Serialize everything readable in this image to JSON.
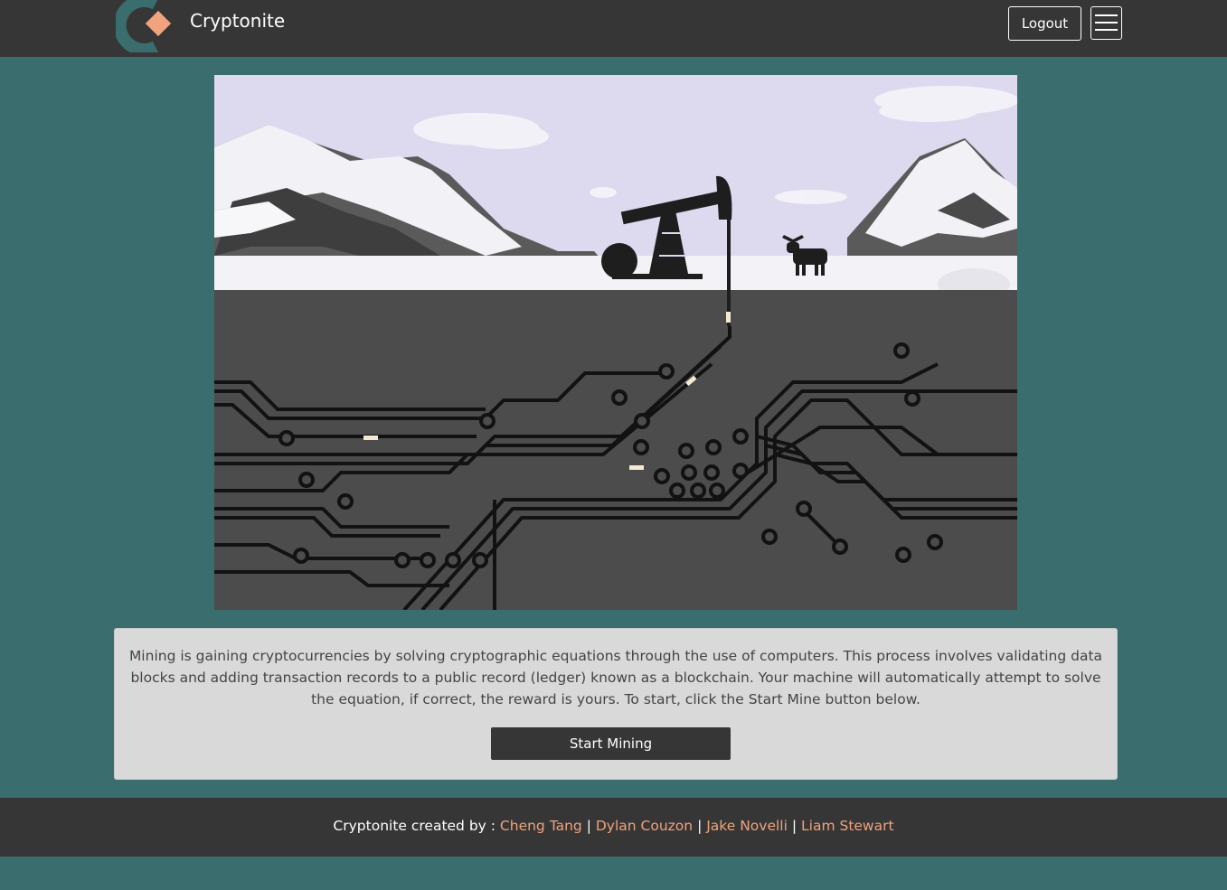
{
  "app": {
    "brand": "Cryptonite",
    "colors": {
      "navbar": "#363636",
      "background": "#3a6e6e",
      "accent": "#f0a37d",
      "logo_c": "#3a6e6e"
    }
  },
  "header": {
    "logout_label": "Logout",
    "menu_icon": "hamburger-icon"
  },
  "hero": {
    "image_description_icon": "oil-pumpjack-circuit-illustration"
  },
  "info": {
    "text": "Mining is gaining cryptocurrencies by solving cryptographic equations through the use of computers. This process involves validating data blocks and adding transaction records to a public record (ledger) known as a blockchain. Your machine will automatically attempt to solve the equation, if correct, the reward is yours. To start, click the Start Mine button below.",
    "start_label": "Start Mining"
  },
  "footer": {
    "prefix": "Cryptonite created by : ",
    "separator": "|",
    "authors": [
      "Cheng Tang",
      "Dylan Couzon",
      "Jake Novelli",
      "Liam Stewart"
    ]
  }
}
